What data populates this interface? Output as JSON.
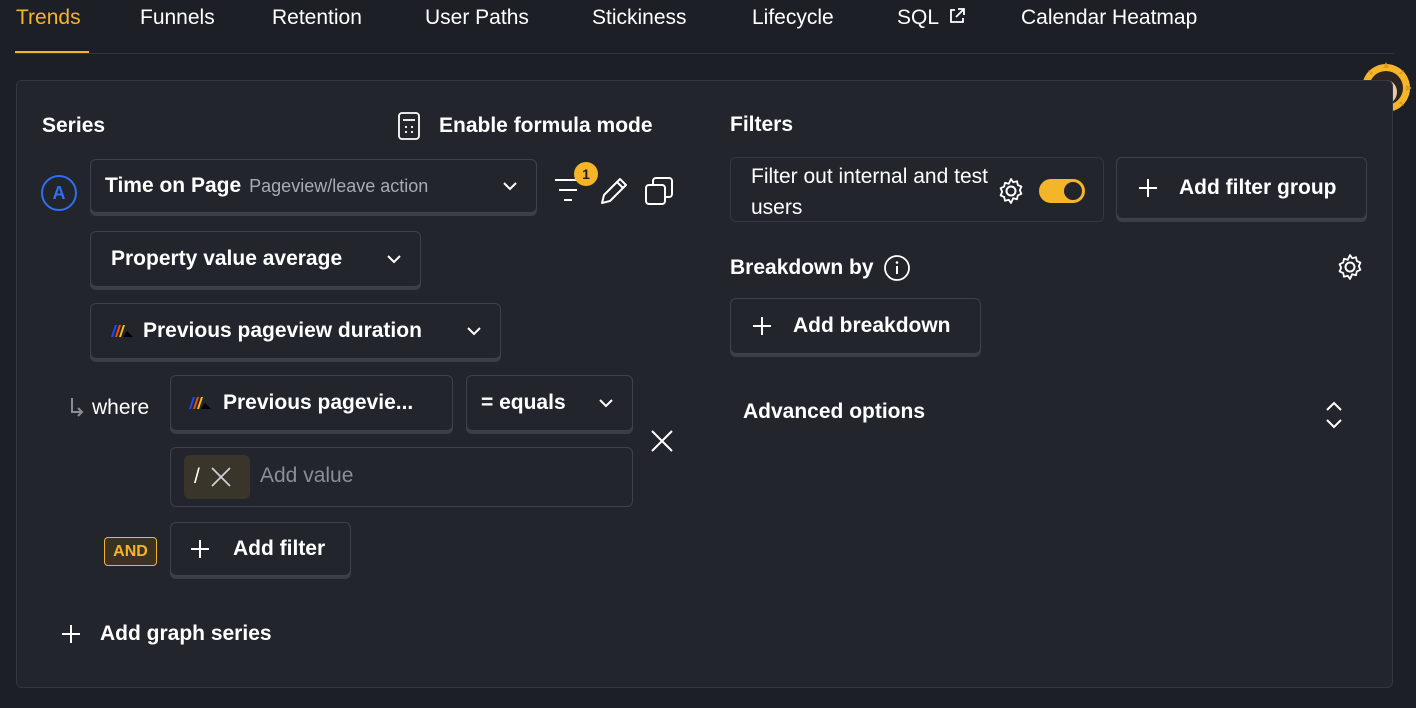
{
  "tabs": [
    {
      "label": "Trends",
      "active": true
    },
    {
      "label": "Funnels"
    },
    {
      "label": "Retention"
    },
    {
      "label": "User Paths"
    },
    {
      "label": "Stickiness"
    },
    {
      "label": "Lifecycle"
    },
    {
      "label": "SQL"
    },
    {
      "label": "Calendar Heatmap"
    }
  ],
  "series": {
    "title": "Series",
    "formula_mode_label": "Enable formula mode",
    "letter": "A",
    "event_name": "Time on Page",
    "event_sub": "Pageview/leave action",
    "filter_count": "1",
    "math_label": "Property value average",
    "property_label": "Previous pageview duration",
    "where_label": "where",
    "where_property": "Previous pagevie...",
    "operator_label": "= equals",
    "regex_label": "/",
    "value_placeholder": "Add value",
    "and_label": "AND",
    "add_filter_label": "Add filter",
    "add_series_label": "Add graph series"
  },
  "filters": {
    "title": "Filters",
    "internal_filter_label": "Filter out internal and test users",
    "internal_filter_enabled": true,
    "add_filter_group_label": "Add filter group"
  },
  "breakdown": {
    "title": "Breakdown by",
    "add_label": "Add breakdown"
  },
  "advanced": {
    "title": "Advanced options"
  },
  "colors": {
    "accent": "#f5b529",
    "series_blue": "#2f6ff2",
    "background": "#1d1f27",
    "panel": "#23252d"
  }
}
